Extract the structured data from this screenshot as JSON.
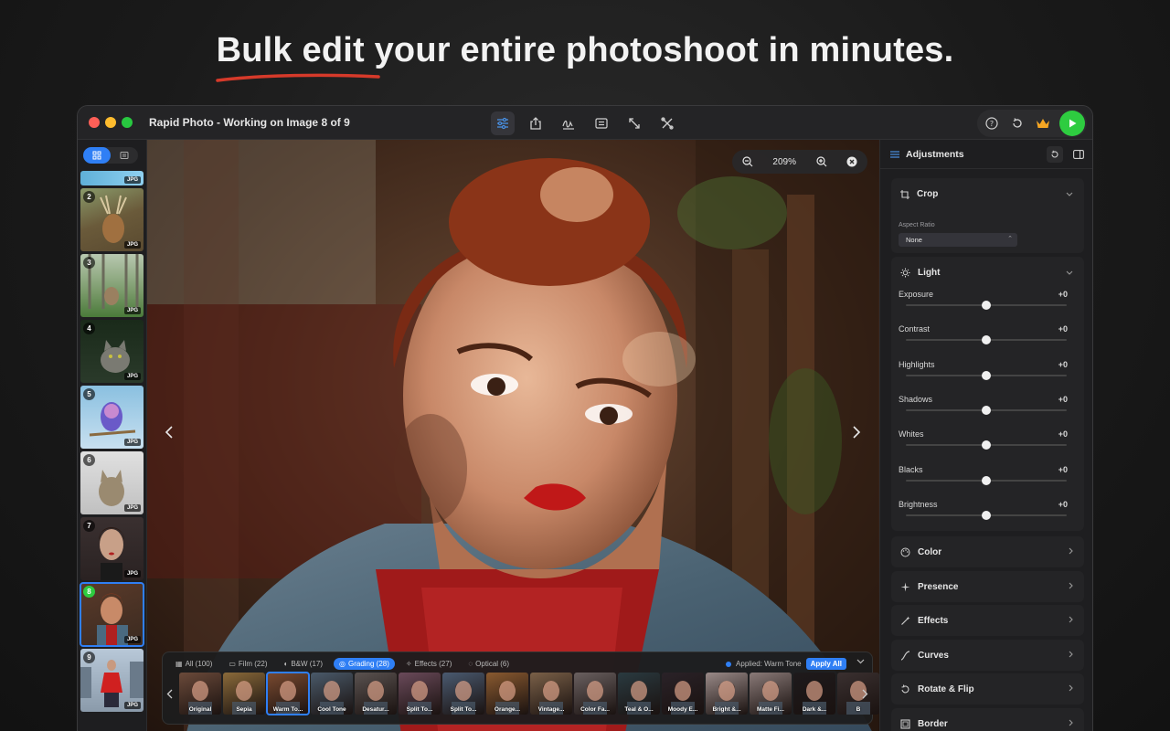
{
  "headline": "Bulk edit your entire photoshoot in minutes.",
  "window": {
    "title": "Rapid Photo - Working on Image 8 of 9"
  },
  "toolbar": {
    "items": [
      "adjustments-icon",
      "share-icon",
      "signature-icon",
      "metadata-icon",
      "resize-icon",
      "tools-icon"
    ]
  },
  "right_tools": [
    "help-icon",
    "reset-icon",
    "crown-icon",
    "export-play-icon"
  ],
  "colors": {
    "accent": "#2f7ff5",
    "green": "#2ecc40",
    "crown": "#f5a623"
  },
  "thumbnails": [
    {
      "num": "",
      "badge": "JPG"
    },
    {
      "num": "2",
      "badge": "JPG"
    },
    {
      "num": "3",
      "badge": "JPG"
    },
    {
      "num": "4",
      "badge": "JPG"
    },
    {
      "num": "5",
      "badge": "JPG"
    },
    {
      "num": "6",
      "badge": "JPG"
    },
    {
      "num": "7",
      "badge": "JPG"
    },
    {
      "num": "8",
      "badge": "JPG"
    },
    {
      "num": "9",
      "badge": "JPG"
    }
  ],
  "rail_bottom": {
    "add": "+",
    "remove": "−"
  },
  "zoom": {
    "value": "209%"
  },
  "filter_tabs": [
    {
      "label": "All (100)",
      "active": false
    },
    {
      "label": "Film (22)",
      "active": false
    },
    {
      "label": "B&W (17)",
      "active": false
    },
    {
      "label": "Grading (28)",
      "active": true
    },
    {
      "label": "Effects (27)",
      "active": false
    },
    {
      "label": "Optical (6)",
      "active": false
    }
  ],
  "applied": {
    "text": "Applied: Warm Tone",
    "button": "Apply All"
  },
  "presets": [
    {
      "label": "Original",
      "tint": "#6b4a3a"
    },
    {
      "label": "Sepia",
      "tint": "#8a6a3a"
    },
    {
      "label": "Warm To...",
      "tint": "#7a4a30"
    },
    {
      "label": "Cool Tone",
      "tint": "#4a5a6a"
    },
    {
      "label": "Desatur...",
      "tint": "#5a5250"
    },
    {
      "label": "Split To...",
      "tint": "#6a4a5a"
    },
    {
      "label": "Split To...",
      "tint": "#4a5a70"
    },
    {
      "label": "Orange...",
      "tint": "#8a5a30"
    },
    {
      "label": "Vintage...",
      "tint": "#7a6048"
    },
    {
      "label": "Color Fa...",
      "tint": "#6a6060"
    },
    {
      "label": "Teal & O...",
      "tint": "#2a3a40"
    },
    {
      "label": "Moody E...",
      "tint": "#2a2228"
    },
    {
      "label": "Bright &...",
      "tint": "#9a8a88"
    },
    {
      "label": "Matte Fi...",
      "tint": "#8a7a78"
    },
    {
      "label": "Dark &...",
      "tint": "#1e1a1c"
    },
    {
      "label": "B",
      "tint": "#3a3030"
    }
  ],
  "panel": {
    "title": "Adjustments",
    "crop": {
      "title": "Crop",
      "aspect_label": "Aspect Ratio",
      "aspect_value": "None"
    },
    "light": {
      "title": "Light",
      "sliders": [
        {
          "label": "Exposure",
          "value": "+0",
          "level": 0.5
        },
        {
          "label": "Contrast",
          "value": "+0",
          "level": 0.5
        },
        {
          "label": "Highlights",
          "value": "+0",
          "level": 0.5
        },
        {
          "label": "Shadows",
          "value": "+0",
          "level": 0.5
        },
        {
          "label": "Whites",
          "value": "+0",
          "level": 0.5
        },
        {
          "label": "Blacks",
          "value": "+0",
          "level": 0.5
        },
        {
          "label": "Brightness",
          "value": "+0",
          "level": 0.5
        }
      ]
    },
    "collapsed": [
      {
        "title": "Color",
        "icon": "palette-icon"
      },
      {
        "title": "Presence",
        "icon": "sparkle-icon"
      },
      {
        "title": "Effects",
        "icon": "wand-icon"
      },
      {
        "title": "Curves",
        "icon": "curve-icon"
      },
      {
        "title": "Rotate & Flip",
        "icon": "rotate-icon"
      },
      {
        "title": "Border",
        "icon": "border-icon"
      }
    ]
  }
}
